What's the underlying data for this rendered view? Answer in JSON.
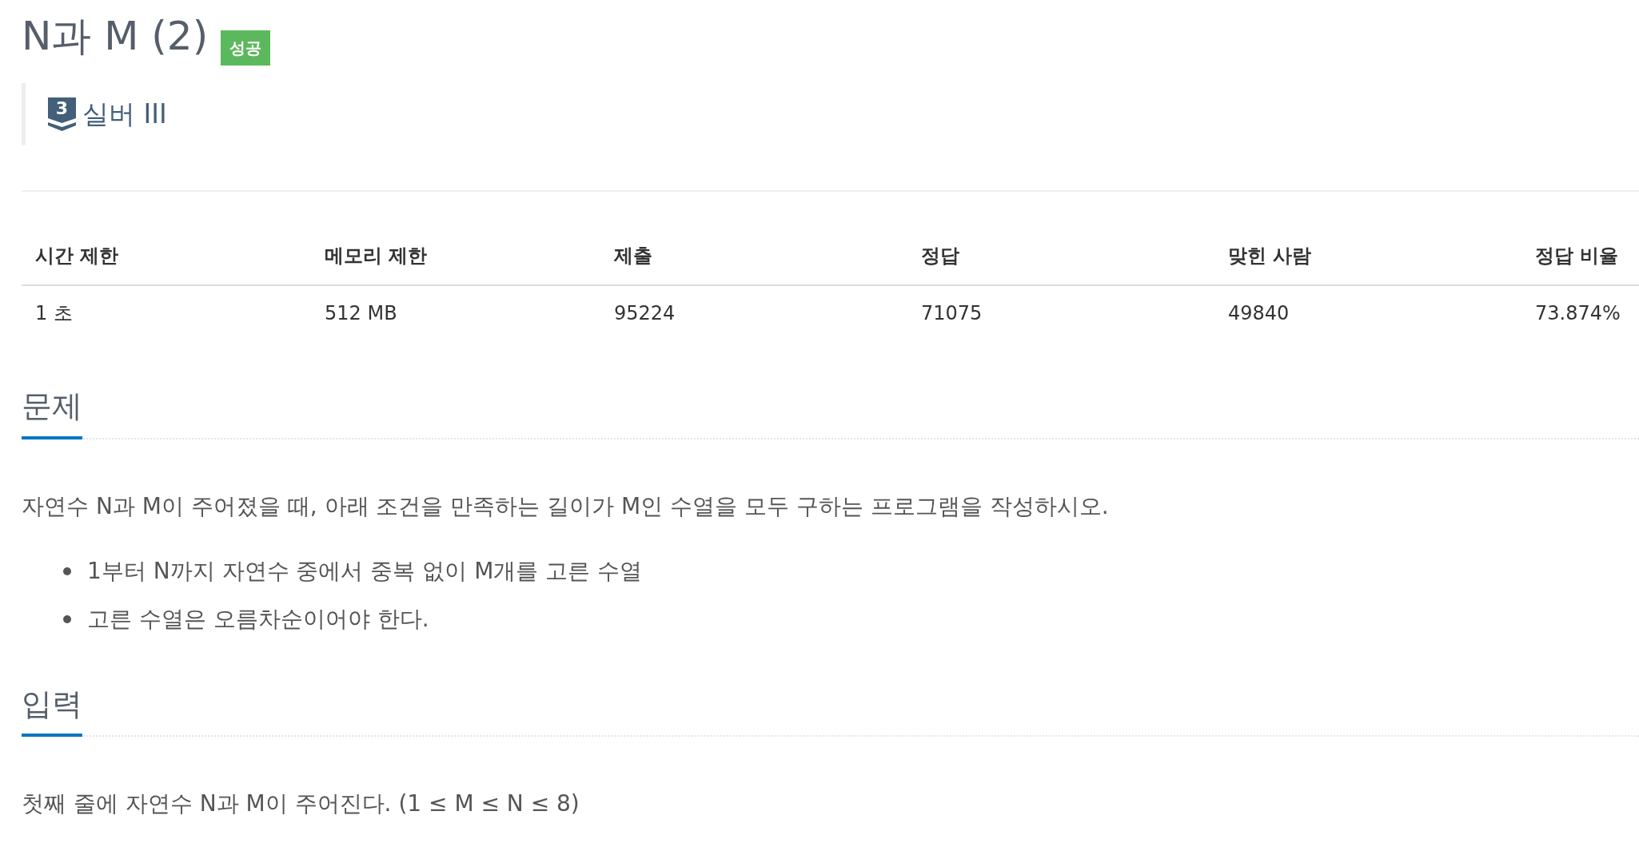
{
  "title": "N과 M (2)",
  "result_badge": {
    "label": "성공",
    "kind": "success"
  },
  "tier": {
    "icon_number": "3",
    "name": "실버 III"
  },
  "stats_table": {
    "columns": [
      "시간 제한",
      "메모리 제한",
      "제출",
      "정답",
      "맞힌 사람",
      "정답 비율"
    ],
    "rows": [
      [
        "1 초",
        "512 MB",
        "95224",
        "71075",
        "49840",
        "73.874%"
      ]
    ]
  },
  "sections": [
    {
      "heading": "문제",
      "body": [
        {
          "kind": "paragraph",
          "text": "자연수 N과 M이 주어졌을 때, 아래 조건을 만족하는 길이가 M인 수열을 모두 구하는 프로그램을 작성하시오."
        },
        {
          "kind": "list",
          "items": [
            "1부터 N까지 자연수 중에서 중복 없이 M개를 고른 수열",
            "고른 수열은 오름차순이어야 한다."
          ]
        }
      ]
    },
    {
      "heading": "입력",
      "body": [
        {
          "kind": "paragraph",
          "text": "첫째 줄에 자연수 N과 M이 주어진다. (1 ≤ M ≤ N ≤ 8)"
        }
      ]
    }
  ]
}
